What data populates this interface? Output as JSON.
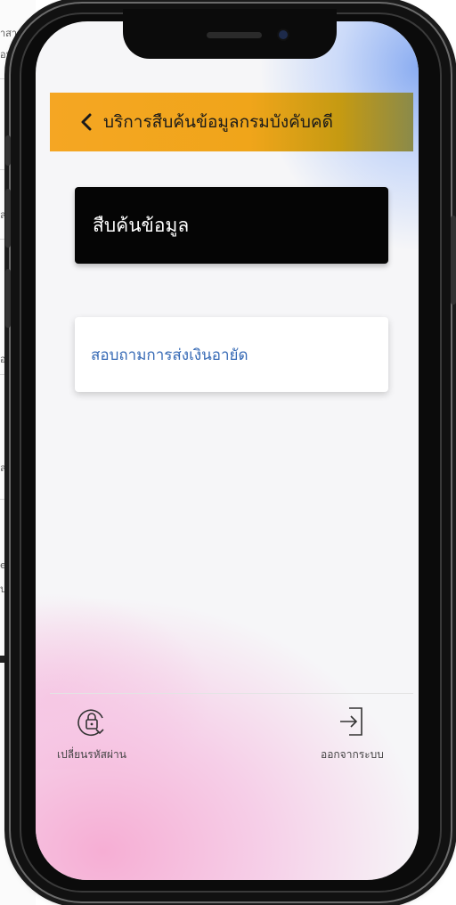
{
  "header": {
    "title": "บริการสืบค้นข้อมูลกรมบังคับคดี",
    "back_icon": "chevron-left-icon"
  },
  "menu": {
    "search_label": "สืบค้นข้อมูล",
    "inquiry_label": "สอบถามการส่งเงินอายัด"
  },
  "footer": {
    "change_password_label": "เปลี่ยนรหัสผ่าน",
    "change_password_icon": "lock-refresh-icon",
    "logout_label": "ออกจากระบบ",
    "logout_icon": "logout-icon"
  },
  "background_fragments": [
    "าสาร",
    "อน",
    "ละ",
    "อมู",
    "ล (",
    "e-r",
    "ป"
  ],
  "colors": {
    "header_bg": "#f5a623",
    "primary_button_bg": "#050505",
    "inquiry_text": "#3569b5"
  }
}
